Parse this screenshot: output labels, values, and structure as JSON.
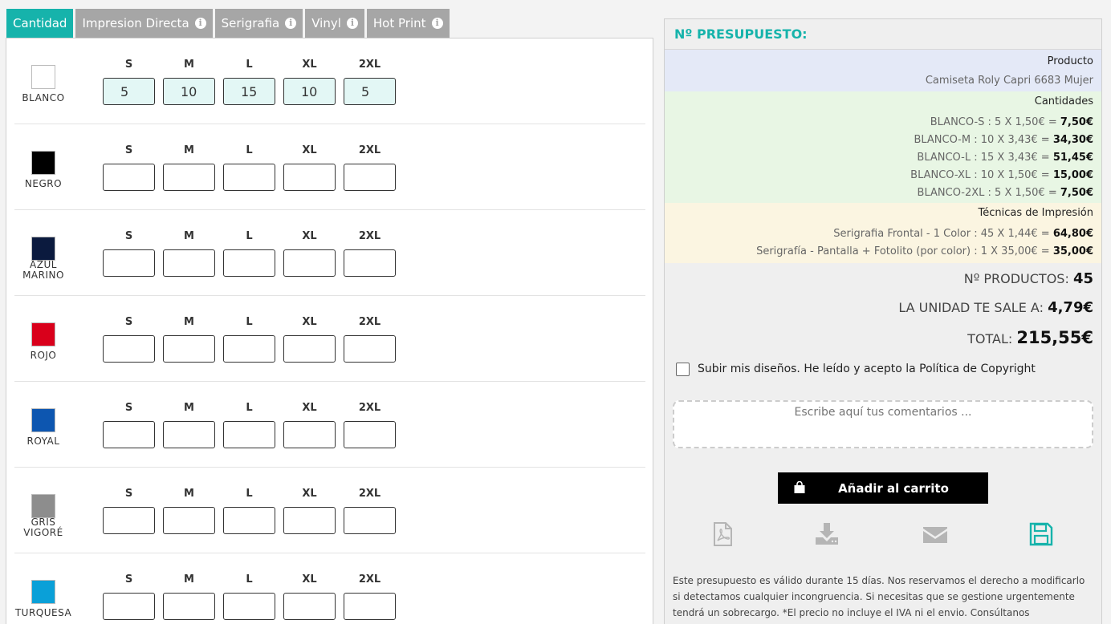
{
  "tabs": [
    {
      "label": "Cantidad",
      "active": true,
      "info": false
    },
    {
      "label": "Impresion Directa",
      "active": false,
      "info": true
    },
    {
      "label": "Serigrafia",
      "active": false,
      "info": true
    },
    {
      "label": "Vinyl",
      "active": false,
      "info": true
    },
    {
      "label": "Hot Print",
      "active": false,
      "info": true
    }
  ],
  "sizes": [
    "S",
    "M",
    "L",
    "XL",
    "2XL"
  ],
  "colors": [
    {
      "name": "BLANCO",
      "swatch": "#ffffff",
      "values": [
        "5",
        "10",
        "15",
        "10",
        "5"
      ]
    },
    {
      "name": "NEGRO",
      "swatch": "#000000",
      "values": [
        "",
        "",
        "",
        "",
        ""
      ]
    },
    {
      "name": "AZUL MARINO",
      "name_lines": [
        "AZUL",
        "MARINO"
      ],
      "swatch": "#0b1a3e",
      "values": [
        "",
        "",
        "",
        "",
        ""
      ]
    },
    {
      "name": "ROJO",
      "swatch": "#d9001b",
      "values": [
        "",
        "",
        "",
        "",
        ""
      ]
    },
    {
      "name": "ROYAL",
      "swatch": "#0d56b0",
      "values": [
        "",
        "",
        "",
        "",
        ""
      ]
    },
    {
      "name": "GRIS VIGORÉ",
      "name_lines": [
        "GRIS",
        "VIGORÉ"
      ],
      "swatch": "#8d8d8d",
      "values": [
        "",
        "",
        "",
        "",
        ""
      ]
    },
    {
      "name": "TURQUESA",
      "swatch": "#0aa0d8",
      "values": [
        "",
        "",
        "",
        "",
        ""
      ]
    }
  ],
  "budget": {
    "title": "Nº PRESUPUESTO:",
    "product_head": "Producto",
    "product": "Camiseta Roly Capri 6683 Mujer",
    "quantities_head": "Cantidades",
    "quantities": [
      {
        "text": "BLANCO-S : 5 X 1,50€ = ",
        "total": "7,50€"
      },
      {
        "text": "BLANCO-M : 10 X 3,43€ = ",
        "total": "34,30€"
      },
      {
        "text": "BLANCO-L : 15 X 3,43€ = ",
        "total": "51,45€"
      },
      {
        "text": "BLANCO-XL : 10 X 1,50€ = ",
        "total": "15,00€"
      },
      {
        "text": "BLANCO-2XL : 5 X 1,50€ = ",
        "total": "7,50€"
      }
    ],
    "techniques_head": "Técnicas de Impresión",
    "techniques": [
      {
        "text": "Serigrafia Frontal - 1 Color : 45 X 1,44€ = ",
        "total": "64,80€"
      },
      {
        "text": "Serigrafía - Pantalla + Fotolito (por color) : 1 X 35,00€ = ",
        "total": "35,00€"
      }
    ],
    "products_label": "Nº PRODUCTOS:",
    "products_value": "45",
    "unit_label": "LA UNIDAD TE SALE A:",
    "unit_value": "4,79€",
    "total_label": "TOTAL:",
    "total_value": "215,55€",
    "copyright_label": "Subir mis diseños. He leído y acepto la Política de Copyright",
    "comments_placeholder": "Escribe aquí tus comentarios ...",
    "cart_label": "Añadir al carrito",
    "disclaimer": "Este presupuesto es válido durante 15 días. Nos reservamos el derecho a modificarlo si detectamos cualquier incongruencia. Si necesitas que se gestione urgentemente tendrá un sobrecargo. *El precio no incluye el IVA ni el envio. Consúltanos"
  },
  "icons": {
    "pdf": "pdf-file-icon",
    "download": "download-icon",
    "email": "envelope-icon",
    "save": "save-floppy-icon",
    "bag": "shopping-bag-icon",
    "info": "info-icon"
  },
  "accent_color": "#16b3ab"
}
